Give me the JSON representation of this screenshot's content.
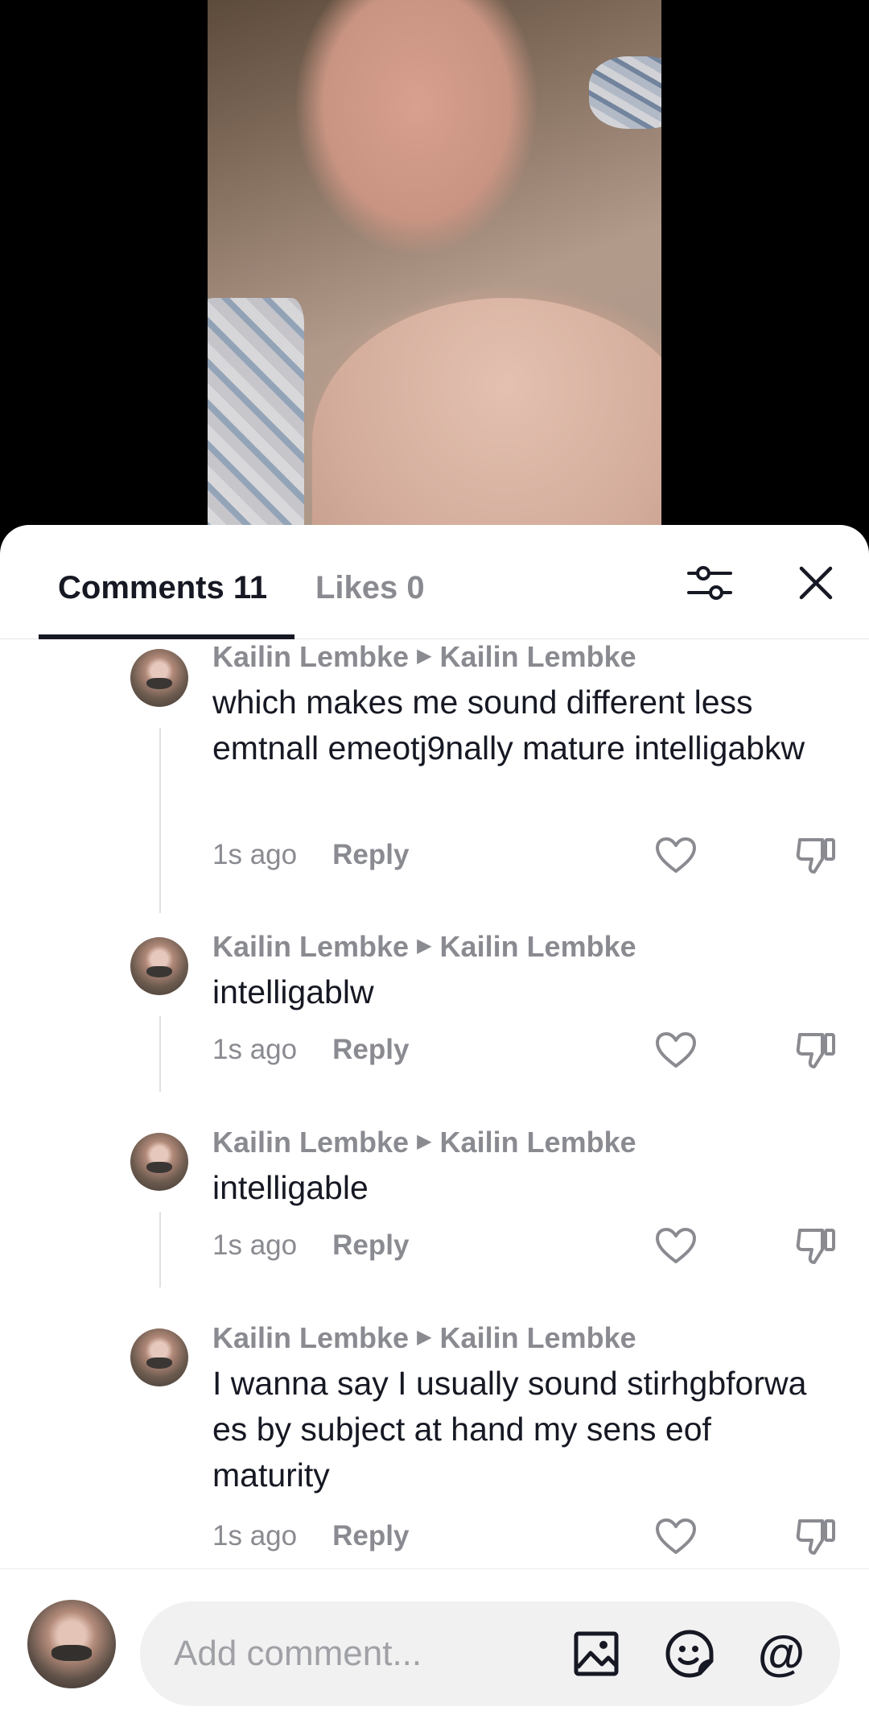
{
  "tabs": {
    "comments_label": "Comments 11",
    "likes_label": "Likes 0"
  },
  "icons": {
    "filter": "sliders-icon",
    "close": "close-icon",
    "like": "heart-outline-icon",
    "dislike": "thumbs-down-outline-icon",
    "image": "image-icon",
    "emoji": "emoji-icon",
    "mention": "@"
  },
  "comments": [
    {
      "author": "Kailin Lembke",
      "reply_to": "Kailin Lembke",
      "text": "which makes me sound different less emtnall emeotj9nally mature intelligabkw",
      "time": "1s ago",
      "reply_label": "Reply"
    },
    {
      "author": "Kailin Lembke",
      "reply_to": "Kailin Lembke",
      "text": "intelligablw",
      "time": "1s ago",
      "reply_label": "Reply"
    },
    {
      "author": "Kailin Lembke",
      "reply_to": "Kailin Lembke",
      "text": "intelligable",
      "time": "1s ago",
      "reply_label": "Reply"
    },
    {
      "author": "Kailin Lembke",
      "reply_to": "Kailin Lembke",
      "text": "I wanna say I usually sound stirhgbforwa es by subject at hand my sens eof maturity",
      "time": "1s ago",
      "reply_label": "Reply"
    }
  ],
  "composer": {
    "placeholder": "Add comment..."
  },
  "colors": {
    "text_primary": "#161823",
    "text_secondary": "#8a8b91",
    "input_bg": "#f1f1f2"
  }
}
